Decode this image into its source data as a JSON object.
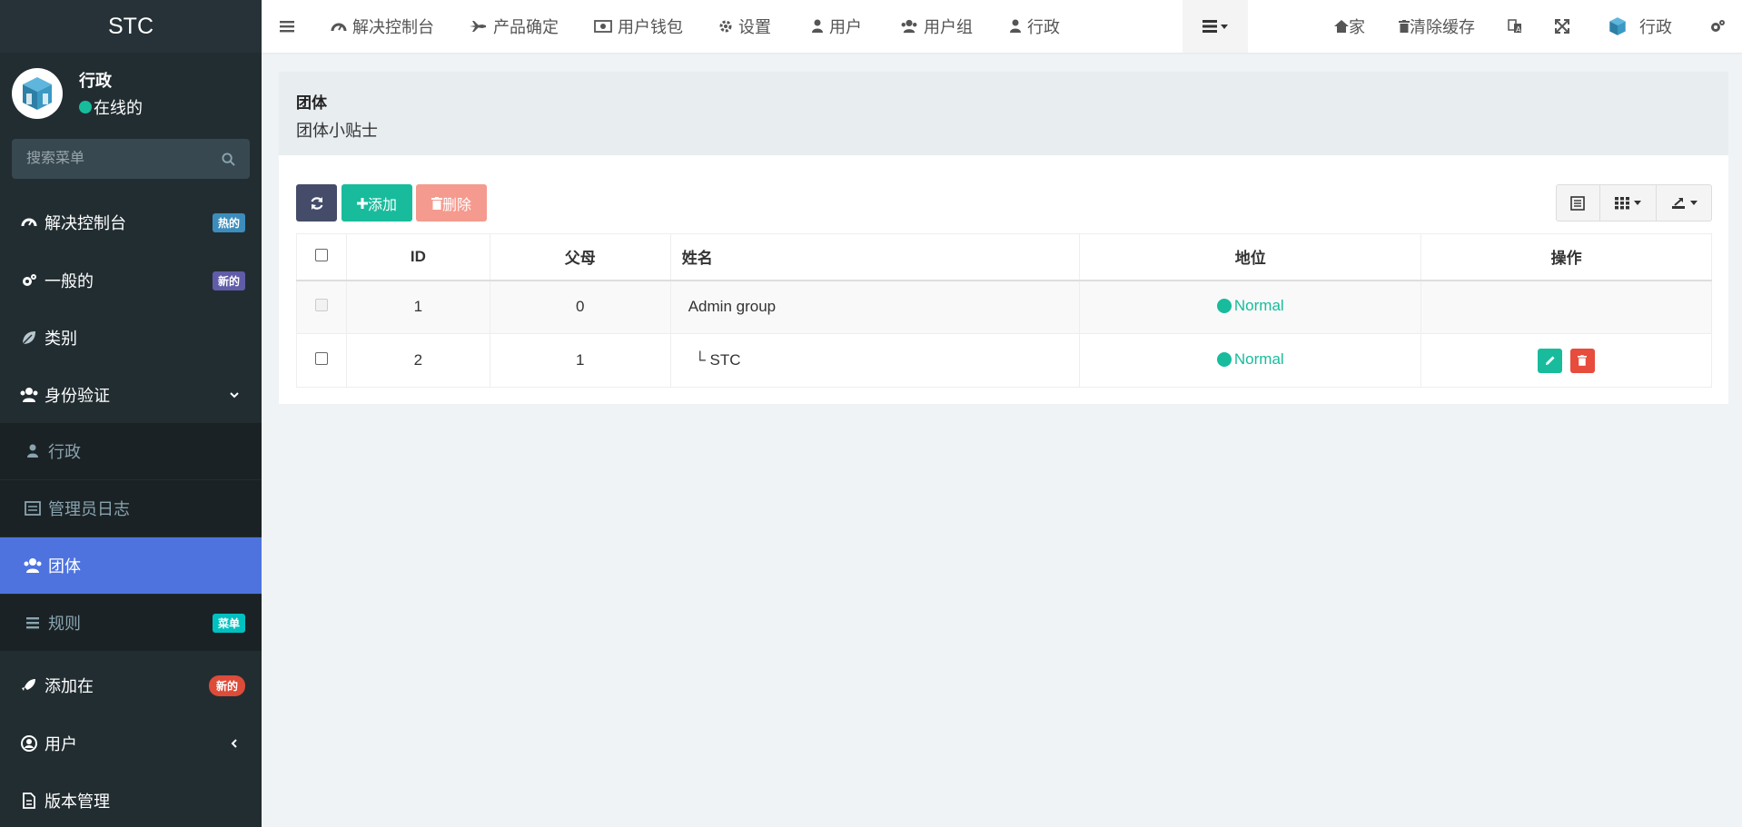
{
  "brand": "STC",
  "user": {
    "name": "行政",
    "status": "在线的"
  },
  "search": {
    "placeholder": "搜索菜单"
  },
  "sidebar": {
    "items": [
      {
        "label": "解决控制台",
        "badge": "热的",
        "badge_color": "#3c8dbc"
      },
      {
        "label": "一般的",
        "badge": "新的",
        "badge_color": "#605ca8"
      },
      {
        "label": "类别"
      },
      {
        "label": "身份验证"
      },
      {
        "label": "行政"
      },
      {
        "label": "管理员日志"
      },
      {
        "label": "团体"
      },
      {
        "label": "规则",
        "badge": "菜单",
        "badge_color": "#00c0c0"
      },
      {
        "label": "添加在",
        "badge": "新的",
        "badge_color": "#dd4b39"
      },
      {
        "label": "用户"
      },
      {
        "label": "版本管理"
      }
    ]
  },
  "topbar": {
    "nav": [
      "解决控制台",
      "产品确定",
      "用户钱包",
      "设置",
      "用户",
      "用户组",
      "行政"
    ],
    "home": "家",
    "clear_cache": "清除缓存",
    "user": "行政"
  },
  "header": {
    "title": "团体",
    "subtitle": "团体小贴士"
  },
  "toolbar": {
    "add": "添加",
    "delete": "删除"
  },
  "table": {
    "columns": [
      "ID",
      "父母",
      "姓名",
      "地位",
      "操作"
    ],
    "rows": [
      {
        "id": "1",
        "parent": "0",
        "name": "Admin group",
        "status": "Normal"
      },
      {
        "id": "2",
        "parent": "1",
        "name": "└ STC",
        "status": "Normal"
      }
    ]
  },
  "colors": {
    "accent": "#4e73df",
    "success": "#18bc9c",
    "danger": "#e74c3c",
    "sidebar": "#222d32"
  }
}
